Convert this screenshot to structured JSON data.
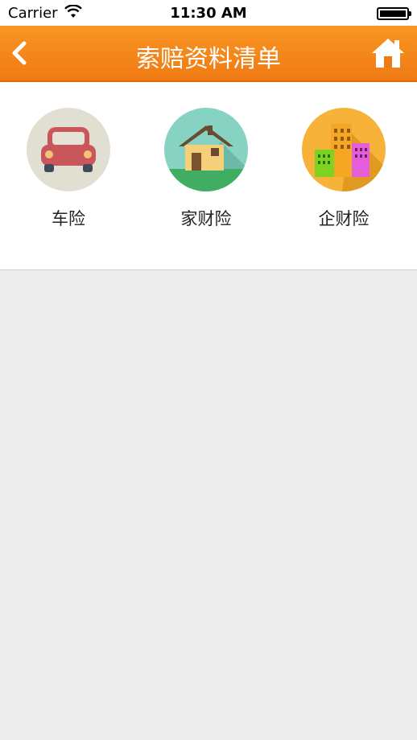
{
  "status_bar": {
    "carrier": "Carrier",
    "time": "11:30 AM",
    "wifi_icon": "wifi-icon",
    "battery_icon": "battery-icon"
  },
  "nav": {
    "title": "索赔资料清单",
    "back_icon": "chevron-left-icon",
    "home_icon": "home-icon",
    "bar_color": "#f28317"
  },
  "categories": [
    {
      "label": "车险",
      "icon": "car-icon",
      "bg": "#e0dfd2"
    },
    {
      "label": "家财险",
      "icon": "house-icon",
      "bg": "#86d3c4"
    },
    {
      "label": "企财险",
      "icon": "buildings-icon",
      "bg": "#f7b23a"
    }
  ],
  "content_bg": "#ececec"
}
